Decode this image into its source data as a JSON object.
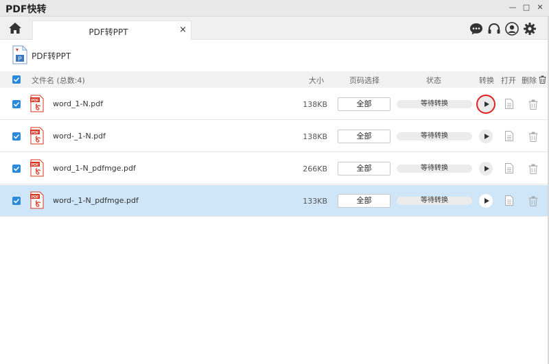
{
  "window": {
    "title": "PDF快转",
    "minimize": "—",
    "maximize": "□",
    "close": "✕"
  },
  "tabs": [
    {
      "label": "PDF转PPT",
      "close": "×"
    }
  ],
  "page": {
    "title": "PDF转PPT",
    "icon_letter": "P"
  },
  "columns": {
    "filename": "文件名 (总数:4)",
    "size": "大小",
    "range": "页码选择",
    "status": "状态",
    "convert": "转换",
    "open": "打开",
    "delete": "删除"
  },
  "files": [
    {
      "name": "word_1-N.pdf",
      "size": "138KB",
      "range": "全部",
      "status": "等待转换",
      "selected": false
    },
    {
      "name": "word-_1-N.pdf",
      "size": "138KB",
      "range": "全部",
      "status": "等待转换",
      "selected": false
    },
    {
      "name": "word_1-N_pdfmge.pdf",
      "size": "266KB",
      "range": "全部",
      "status": "等待转换",
      "selected": false
    },
    {
      "name": "word-_1-N_pdfmge.pdf",
      "size": "133KB",
      "range": "全部",
      "status": "等待转换",
      "selected": true
    }
  ],
  "pdf_badge": "PDF",
  "colors": {
    "accent": "#2b89d9",
    "selected_row": "#cfe5f8",
    "highlight_ring": "#e02020",
    "pdf_red": "#d9321f"
  }
}
